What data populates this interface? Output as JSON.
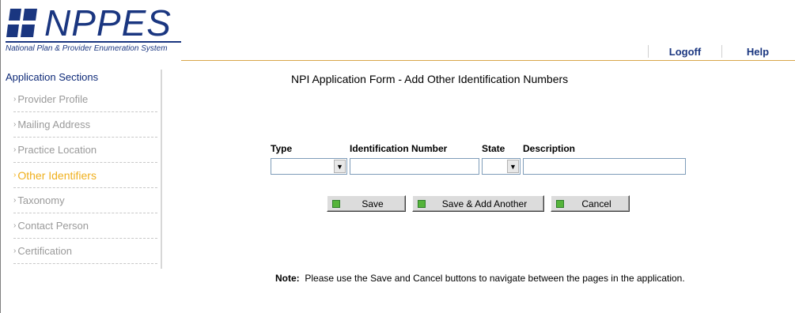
{
  "header": {
    "logo_text": "NPPES",
    "logo_subtitle": "National Plan & Provider Enumeration System",
    "links": [
      {
        "label": "Logoff"
      },
      {
        "label": "Help"
      }
    ]
  },
  "sidebar": {
    "title": "Application Sections",
    "items": [
      {
        "label": "Provider Profile",
        "active": false
      },
      {
        "label": "Mailing Address",
        "active": false
      },
      {
        "label": "Practice Location",
        "active": false
      },
      {
        "label": "Other Identifiers",
        "active": true
      },
      {
        "label": "Taxonomy",
        "active": false
      },
      {
        "label": "Contact Person",
        "active": false
      },
      {
        "label": "Certification",
        "active": false
      }
    ]
  },
  "main": {
    "title": "NPI Application Form - Add Other Identification Numbers",
    "form": {
      "type_label": "Type",
      "type_value": "",
      "id_label": "Identification Number",
      "id_value": "",
      "state_label": "State",
      "state_value": "",
      "desc_label": "Description",
      "desc_value": ""
    },
    "buttons": {
      "save": "Save",
      "save_add": "Save & Add Another",
      "cancel": "Cancel"
    },
    "note": {
      "label": "Note:",
      "text": "Please use the Save and Cancel buttons to navigate between the pages in the application."
    }
  },
  "colors": {
    "brand": "#1a3680",
    "active_item": "#f0b01e",
    "button_marker": "#55b43a",
    "header_rule": "#d8a64a"
  }
}
